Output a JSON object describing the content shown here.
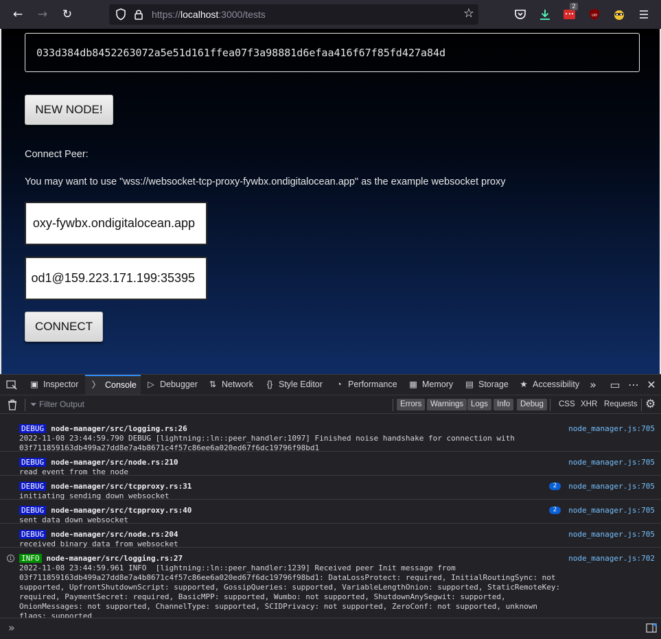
{
  "browser": {
    "url_prefix": "https://",
    "url_host": "localhost",
    "url_path": ":3000/tests",
    "badge_count": "2",
    "icons": [
      "back-icon",
      "forward-icon",
      "reload-icon",
      "shield-icon",
      "lock-icon",
      "star-icon",
      "pocket-icon",
      "download-icon",
      "extension-icon",
      "ublock-icon",
      "privacy-icon",
      "menu-icon"
    ]
  },
  "page": {
    "pubkey": "033d384db8452263072a5e51d161ffea07f3a98881d6efaa416f67f85fd427a84d",
    "new_node_label": "NEW NODE!",
    "connect_peer_label": "Connect Peer:",
    "proxy_hint": "You may want to use \"wss://websocket-tcp-proxy-fywbx.ondigitalocean.app\" as the example websocket proxy",
    "proxy_input_value": "oxy-fywbx.ondigitalocean.app",
    "peer_input_value": "od1@159.223.171.199:35395",
    "connect_label": "CONNECT"
  },
  "devtools": {
    "tabs": {
      "inspector": "Inspector",
      "console": "Console",
      "debugger": "Debugger",
      "network": "Network",
      "style_editor": "Style Editor",
      "performance": "Performance",
      "memory": "Memory",
      "storage": "Storage",
      "accessibility": "Accessibility"
    },
    "filter_placeholder": "Filter Output",
    "levels": {
      "errors": "Errors",
      "warnings": "Warnings",
      "logs": "Logs",
      "info": "Info",
      "debug": "Debug"
    },
    "types": {
      "css": "CSS",
      "xhr": "XHR",
      "requests": "Requests"
    },
    "entries": [
      {
        "level": "DEBUG",
        "source": "node-manager/src/logging.rs:26",
        "location": "node_manager.js:705",
        "text": "2022-11-08 23:44:59.790 DEBUG [lightning::ln::peer_handler:1097] Finished noise handshake for connection with\n03f711859163db499a27dd8e7a4b8671c4f57c86ee6a020ed67f6dc19796f98bd1"
      },
      {
        "level": "DEBUG",
        "source": "node-manager/src/node.rs:210",
        "location": "node_manager.js:705",
        "text": "read event from the node"
      },
      {
        "level": "DEBUG",
        "source": "node-manager/src/tcpproxy.rs:31",
        "location": "node_manager.js:705",
        "count": "2",
        "text": "initiating sending down websocket"
      },
      {
        "level": "DEBUG",
        "source": "node-manager/src/tcpproxy.rs:40",
        "location": "node_manager.js:705",
        "count": "2",
        "text": "sent data down websocket"
      },
      {
        "level": "DEBUG",
        "source": "node-manager/src/node.rs:204",
        "location": "node_manager.js:705",
        "text": "received binary data from websocket"
      },
      {
        "level": "INFO",
        "source": "node-manager/src/logging.rs:27",
        "location": "node_manager.js:702",
        "text": "2022-11-08 23:44:59.961 INFO  [lightning::ln::peer_handler:1239] Received peer Init message from\n03f711859163db499a27dd8e7a4b8671c4f57c86ee6a020ed67f6dc19796f98bd1: DataLossProtect: required, InitialRoutingSync: not\nsupported, UpfrontShutdownScript: supported, GossipQueries: supported, VariableLengthOnion: supported, StaticRemoteKey:\nrequired, PaymentSecret: required, BasicMPP: supported, Wumbo: not supported, ShutdownAnySegwit: supported,\nOnionMessages: not supported, ChannelType: supported, SCIDPrivacy: not supported, ZeroConf: not supported, unknown\nflags: supported"
      }
    ]
  }
}
